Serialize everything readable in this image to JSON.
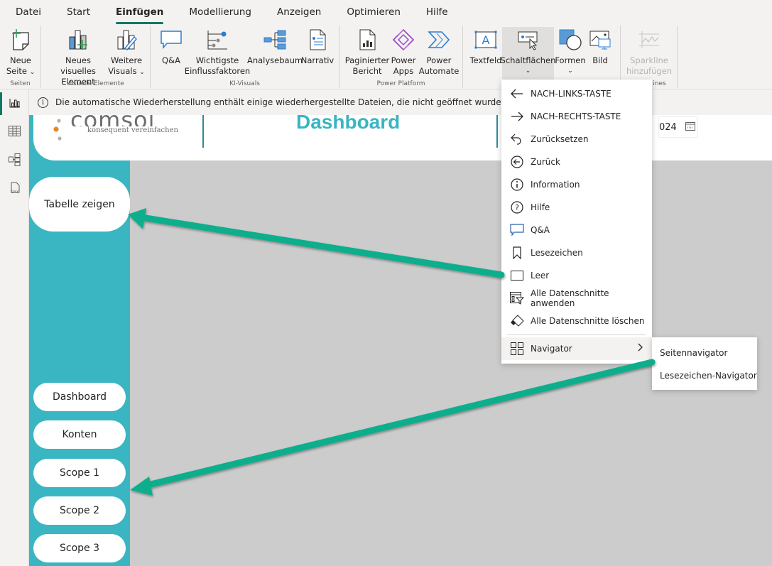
{
  "menubar": {
    "items": [
      "Datei",
      "Start",
      "Einfügen",
      "Modellierung",
      "Anzeigen",
      "Optimieren",
      "Hilfe"
    ],
    "active": "Einfügen"
  },
  "ribbon": {
    "groups": {
      "seiten": "Seiten",
      "visuelle": "Visuelle Elemente",
      "ki": "KI-Visuals",
      "power": "Power Platform",
      "sparklines": "ines"
    },
    "buttons": {
      "neue_seite": [
        "Neue",
        "Seite"
      ],
      "neues_visual": [
        "Neues visuelles",
        "Element"
      ],
      "weitere_visuals": [
        "Weitere",
        "Visuals"
      ],
      "qa": "Q&A",
      "einfluss": [
        "Wichtigste",
        "Einflussfaktoren"
      ],
      "analysebaum": "Analysebaum",
      "narrativ": "Narrativ",
      "paginiert": [
        "Paginierter",
        "Bericht"
      ],
      "power_apps": [
        "Power",
        "Apps"
      ],
      "power_automate": [
        "Power",
        "Automate"
      ],
      "textfeld": "Textfeld",
      "schaltflaechen": "Schaltflächen",
      "formen": "Formen",
      "bild": "Bild",
      "sparkline": [
        "Sparkline",
        "hinzufügen"
      ]
    }
  },
  "notification": {
    "text": "Die automatische Wiederherstellung enthält einige wiederhergestellte Dateien, die nicht geöffnet wurden."
  },
  "rail": [
    "report-view",
    "table-view",
    "model-view",
    "dax-view"
  ],
  "report": {
    "logo_brand": "comsol",
    "logo_tagline": "konsequent vereinfachen",
    "title": "Dashboard",
    "date_value": "024",
    "table_button": "Tabelle zeigen",
    "nav_buttons": [
      "Dashboard",
      "Konten",
      "Scope 1",
      "Scope 2",
      "Scope 3"
    ]
  },
  "dropdown": {
    "items": [
      {
        "label": "NACH-LINKS-TASTE",
        "icon": "arrow-left-icon"
      },
      {
        "label": "NACH-RECHTS-TASTE",
        "icon": "arrow-right-icon"
      },
      {
        "label": "Zurücksetzen",
        "icon": "reset-icon"
      },
      {
        "label": "Zurück",
        "icon": "back-circle-icon"
      },
      {
        "label": "Information",
        "icon": "info-icon"
      },
      {
        "label": "Hilfe",
        "icon": "help-icon"
      },
      {
        "label": "Q&A",
        "icon": "qa-icon"
      },
      {
        "label": "Lesezeichen",
        "icon": "bookmark-icon"
      },
      {
        "label": "Leer",
        "icon": "blank-icon"
      },
      {
        "label": "Alle Datenschnitte anwenden",
        "icon": "apply-slicers-icon"
      },
      {
        "label": "Alle Datenschnitte löschen",
        "icon": "clear-slicers-icon"
      },
      {
        "label": "Navigator",
        "icon": "navigator-icon"
      }
    ],
    "submenu": [
      "Seitennavigator",
      "Lesezeichen-Navigator"
    ]
  },
  "colors": {
    "accent": "#117865",
    "teal": "#3ab5c2",
    "annotation_arrow": "#0aae8c",
    "canvas": "#cccccc"
  }
}
